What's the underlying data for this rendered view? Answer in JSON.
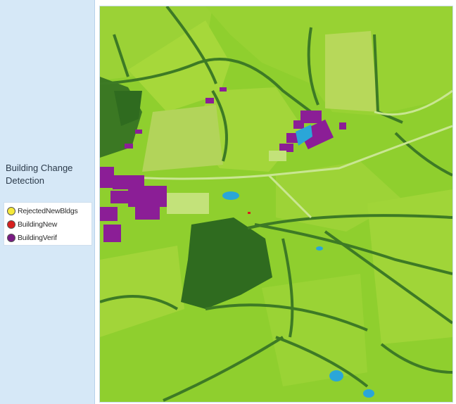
{
  "panel": {
    "title": "Building Change Detection"
  },
  "legend": {
    "items": [
      {
        "label": "RejectedNewBldgs",
        "color": "#f5e93a"
      },
      {
        "label": "BuildingNew",
        "color": "#d8201f"
      },
      {
        "label": "BuildingVerif",
        "color": "#7a1b84"
      }
    ]
  },
  "map": {
    "colors": {
      "field_light": "#a6d83a",
      "field_mid": "#8fcf2e",
      "forest": "#2f6b1f",
      "hedgerow": "#3d7a25",
      "path": "#c9e692",
      "building_verified": "#8b1e96",
      "water": "#2aa6d8"
    }
  }
}
